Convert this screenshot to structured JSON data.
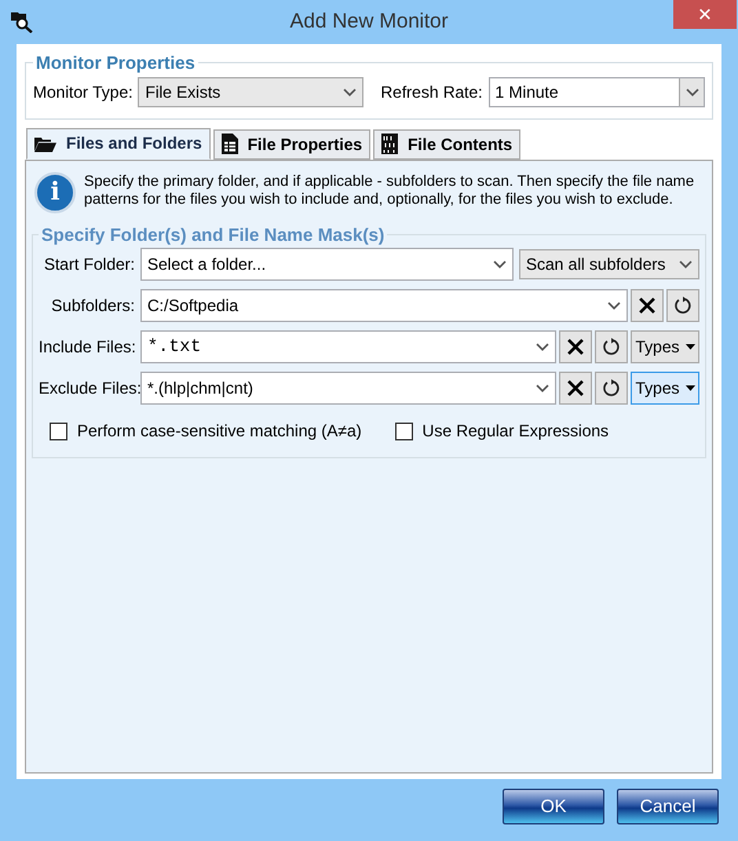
{
  "window": {
    "title": "Add New Monitor",
    "close": "✕"
  },
  "monitor_properties": {
    "legend": "Monitor Properties",
    "monitor_type": {
      "label": "Monitor Type:",
      "value": "File Exists"
    },
    "refresh_rate": {
      "label": "Refresh Rate:",
      "value": "1 Minute"
    }
  },
  "tabs": [
    {
      "label": "Files and Folders",
      "kind": "folder",
      "selected": true
    },
    {
      "label": "File Properties",
      "kind": "sheet",
      "selected": false
    },
    {
      "label": "File Contents",
      "kind": "binary",
      "selected": false
    }
  ],
  "info": {
    "icon": "i",
    "text": "Specify the primary folder, and if applicable - subfolders to scan. Then specify the file name patterns for the files you wish to include and, optionally, for the files you wish to exclude."
  },
  "mask_group": {
    "legend": "Specify Folder(s) and File Name Mask(s)",
    "start_folder": {
      "label": "Start Folder:",
      "value": "Select a folder...",
      "scan": "Scan all subfolders"
    },
    "rows": [
      {
        "label": "Subfolders:",
        "value": "C:/Softpedia",
        "mono": false
      },
      {
        "label": "Include Files:",
        "value": "*.txt",
        "mono": true,
        "types": {
          "label": "Types",
          "focused": false
        }
      },
      {
        "label": "Exclude Files:",
        "value": "*.(hlp|chm|cnt)",
        "mono": false,
        "types": {
          "label": "Types",
          "focused": true
        }
      }
    ],
    "checkboxes": [
      {
        "label": "Perform case-sensitive matching (A≠a)",
        "checked": false
      },
      {
        "label": "Use Regular Expressions",
        "checked": false
      }
    ]
  },
  "buttons": [
    {
      "label": "OK"
    },
    {
      "label": "Cancel"
    }
  ]
}
